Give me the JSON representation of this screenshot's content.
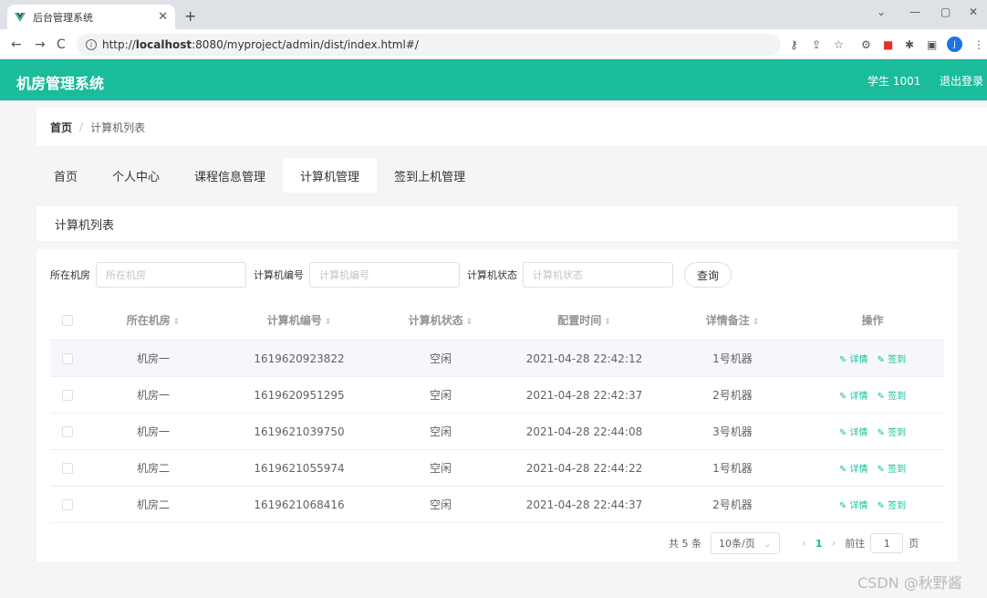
{
  "browser": {
    "tab_title": "后台管理系统",
    "url_prefix": "http://",
    "url_host": "localhost",
    "url_rest": ":8080/myproject/admin/dist/index.html#/"
  },
  "header": {
    "title": "机房管理系统",
    "user": "学生 1001",
    "logout": "退出登录",
    "accent": "#1abc9c"
  },
  "breadcrumb": {
    "home": "首页",
    "sep": "/",
    "current": "计算机列表"
  },
  "menu": [
    {
      "label": "首页"
    },
    {
      "label": "个人中心"
    },
    {
      "label": "课程信息管理"
    },
    {
      "label": "计算机管理"
    },
    {
      "label": "签到上机管理"
    }
  ],
  "list_title": "计算机列表",
  "search": {
    "room_label": "所在机房",
    "room_placeholder": "所在机房",
    "no_label": "计算机编号",
    "no_placeholder": "计算机编号",
    "status_label": "计算机状态",
    "status_placeholder": "计算机状态",
    "query": "查询"
  },
  "table": {
    "headers": [
      "所在机房",
      "计算机编号",
      "计算机状态",
      "配置时间",
      "详情备注",
      "操作"
    ],
    "rows": [
      {
        "room": "机房一",
        "no": "1619620923822",
        "status": "空闲",
        "time": "2021-04-28 22:42:12",
        "note": "1号机器"
      },
      {
        "room": "机房一",
        "no": "1619620951295",
        "status": "空闲",
        "time": "2021-04-28 22:42:37",
        "note": "2号机器"
      },
      {
        "room": "机房一",
        "no": "1619621039750",
        "status": "空闲",
        "time": "2021-04-28 22:44:08",
        "note": "3号机器"
      },
      {
        "room": "机房二",
        "no": "1619621055974",
        "status": "空闲",
        "time": "2021-04-28 22:44:22",
        "note": "1号机器"
      },
      {
        "room": "机房二",
        "no": "1619621068416",
        "status": "空闲",
        "time": "2021-04-28 22:44:37",
        "note": "2号机器"
      }
    ],
    "op_detail": "详情",
    "op_sign": "签到"
  },
  "pager": {
    "total": "共 5 条",
    "size": "10条/页",
    "current": "1",
    "goto_label": "前往",
    "goto_value": "1",
    "page_unit": "页"
  },
  "watermark": "CSDN @秋野酱"
}
